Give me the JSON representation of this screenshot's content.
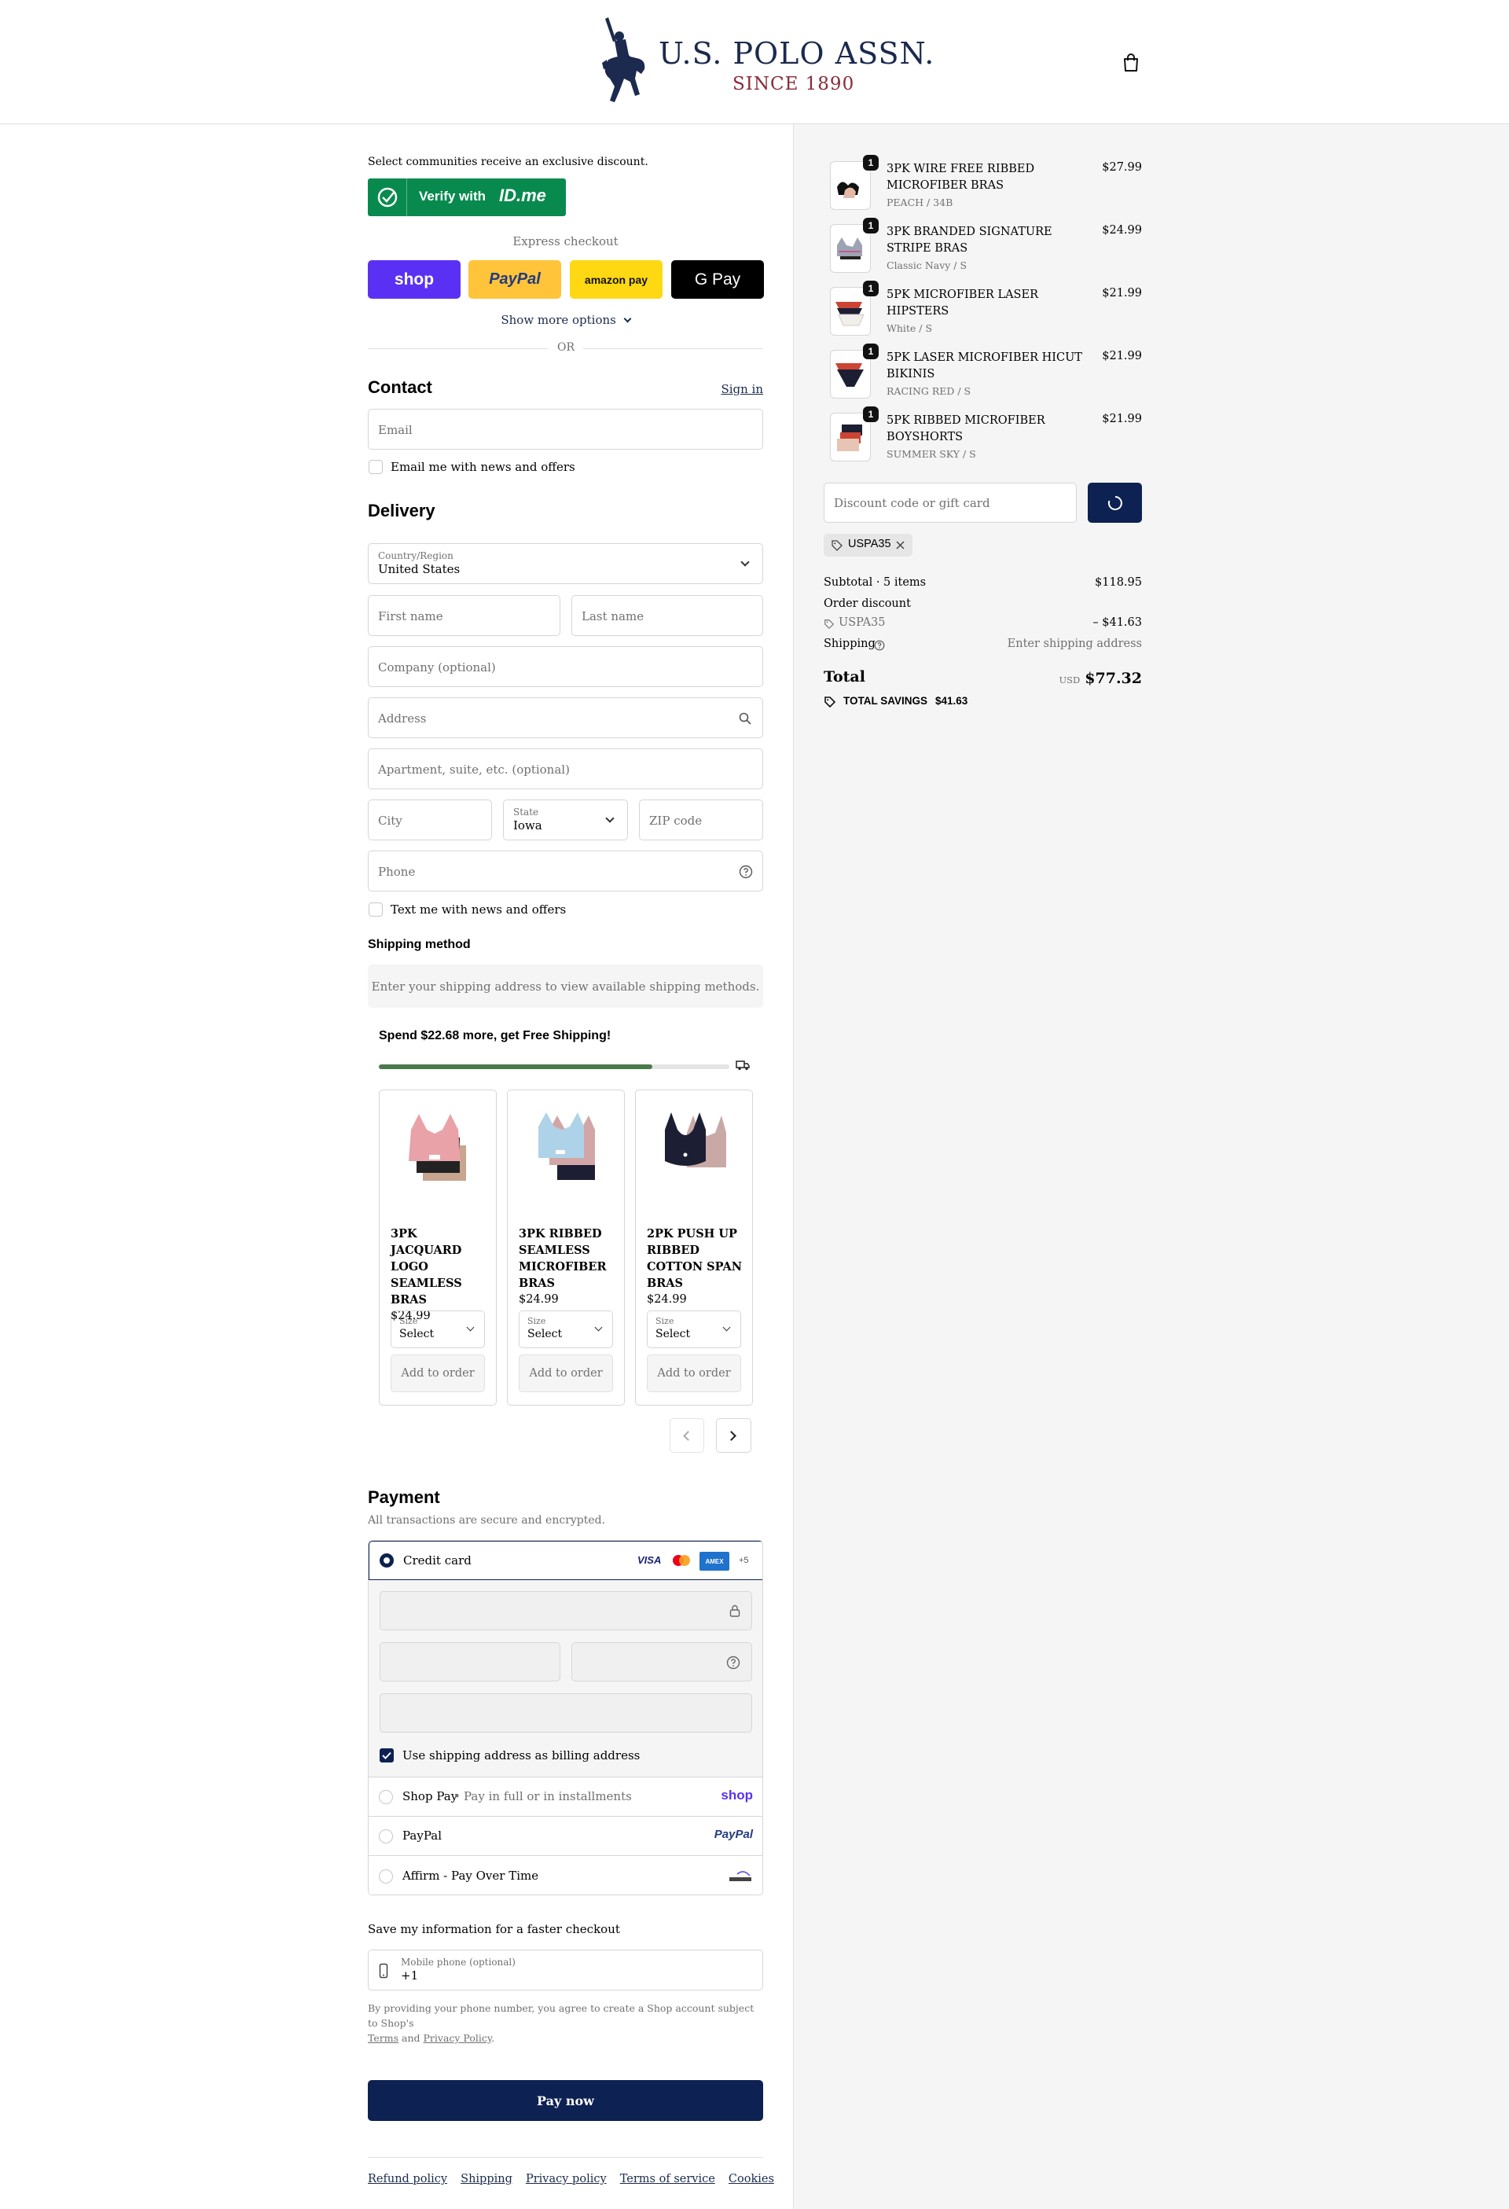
{
  "brand": {
    "name": "U.S. POLO ASSN.",
    "tagline": "SINCE 1890"
  },
  "idme": {
    "intro": "Select communities receive an exclusive discount.",
    "button_prefix": "Verify with",
    "button_brand": "ID.me"
  },
  "express": {
    "title": "Express checkout",
    "buttons": [
      "shop",
      "PayPal",
      "amazon pay",
      "G Pay"
    ],
    "more": "Show more options",
    "or": "OR"
  },
  "contact": {
    "title": "Contact",
    "sign_in": "Sign in",
    "email_placeholder": "Email",
    "newsletter": "Email me with news and offers"
  },
  "delivery": {
    "title": "Delivery",
    "country_label": "Country/Region",
    "country_value": "United States",
    "first_name": "First name",
    "last_name": "Last name",
    "company": "Company (optional)",
    "address": "Address",
    "apartment": "Apartment, suite, etc. (optional)",
    "city": "City",
    "state_label": "State",
    "state_value": "Iowa",
    "zip": "ZIP code",
    "phone": "Phone",
    "sms": "Text me with news and offers"
  },
  "shipping_method": {
    "title": "Shipping method",
    "notice": "Enter your shipping address to view available shipping methods."
  },
  "upsell": {
    "headline": "Spend $22.68 more, get Free Shipping!",
    "progress": 0.78,
    "products": [
      {
        "name": "3PK JACQUARD LOGO SEAMLESS BRAS",
        "price": "$24.99",
        "size_label": "Size",
        "size_value": "Select",
        "button": "Add to order"
      },
      {
        "name": "3PK RIBBED SEAMLESS MICROFIBER BRAS",
        "price": "$24.99",
        "size_label": "Size",
        "size_value": "Select",
        "button": "Add to order"
      },
      {
        "name": "2PK PUSH UP RIBBED COTTON SPAN BRAS",
        "price": "$24.99",
        "size_label": "Size",
        "size_value": "Select",
        "button": "Add to order"
      }
    ]
  },
  "payment": {
    "title": "Payment",
    "subtitle": "All transactions are secure and encrypted.",
    "credit_card": "Credit card",
    "card_more": "+5",
    "billing_same": "Use shipping address as billing address",
    "shop_pay": "Shop Pay",
    "shop_pay_note": "Pay in full or in installments",
    "paypal": "PayPal",
    "affirm": "Affirm - Pay Over Time",
    "card_brands": [
      "VISA",
      "AMEX"
    ]
  },
  "save_info": {
    "title": "Save my information for a faster checkout",
    "phone_label": "Mobile phone (optional)",
    "phone_value": "+1",
    "legal_1": "By providing your phone number, you agree to create a Shop account subject to Shop's",
    "terms": "Terms",
    "and": "and",
    "privacy": "Privacy Policy",
    "period": "."
  },
  "pay_now": "Pay now",
  "footer": [
    "Refund policy",
    "Shipping",
    "Privacy policy",
    "Terms of service",
    "Cookies"
  ],
  "cart": {
    "items": [
      {
        "qty": "1",
        "name": "3PK WIRE FREE RIBBED MICROFIBER BRAS",
        "variant": "PEACH / 34B",
        "price": "$27.99"
      },
      {
        "qty": "1",
        "name": "3PK BRANDED SIGNATURE STRIPE BRAS",
        "variant": "Classic Navy / S",
        "price": "$24.99"
      },
      {
        "qty": "1",
        "name": "5PK MICROFIBER LASER HIPSTERS",
        "variant": "White / S",
        "price": "$21.99"
      },
      {
        "qty": "1",
        "name": "5PK LASER MICROFIBER HICUT BIKINIS",
        "variant": "RACING RED / S",
        "price": "$21.99"
      },
      {
        "qty": "1",
        "name": "5PK RIBBED MICROFIBER BOYSHORTS",
        "variant": "SUMMER SKY / S",
        "price": "$21.99"
      }
    ],
    "discount_placeholder": "Discount code or gift card",
    "applied_code": "USPA35",
    "subtotal_label": "Subtotal · 5 items",
    "subtotal_value": "$118.95",
    "order_discount_label": "Order discount",
    "order_discount_code": "USPA35",
    "order_discount_value": "– $41.63",
    "shipping_label": "Shipping",
    "shipping_value": "Enter shipping address",
    "total_label": "Total",
    "total_currency": "USD",
    "total_value": "$77.32",
    "savings_label": "TOTAL SAVINGS",
    "savings_value": "$41.63"
  },
  "colors": {
    "primary": "#0d2152",
    "progress": "#4a7a4c",
    "idme": "#088a4e",
    "shop": "#5a31f4",
    "paypal": "#ffc439",
    "amazon": "#ffd814"
  }
}
